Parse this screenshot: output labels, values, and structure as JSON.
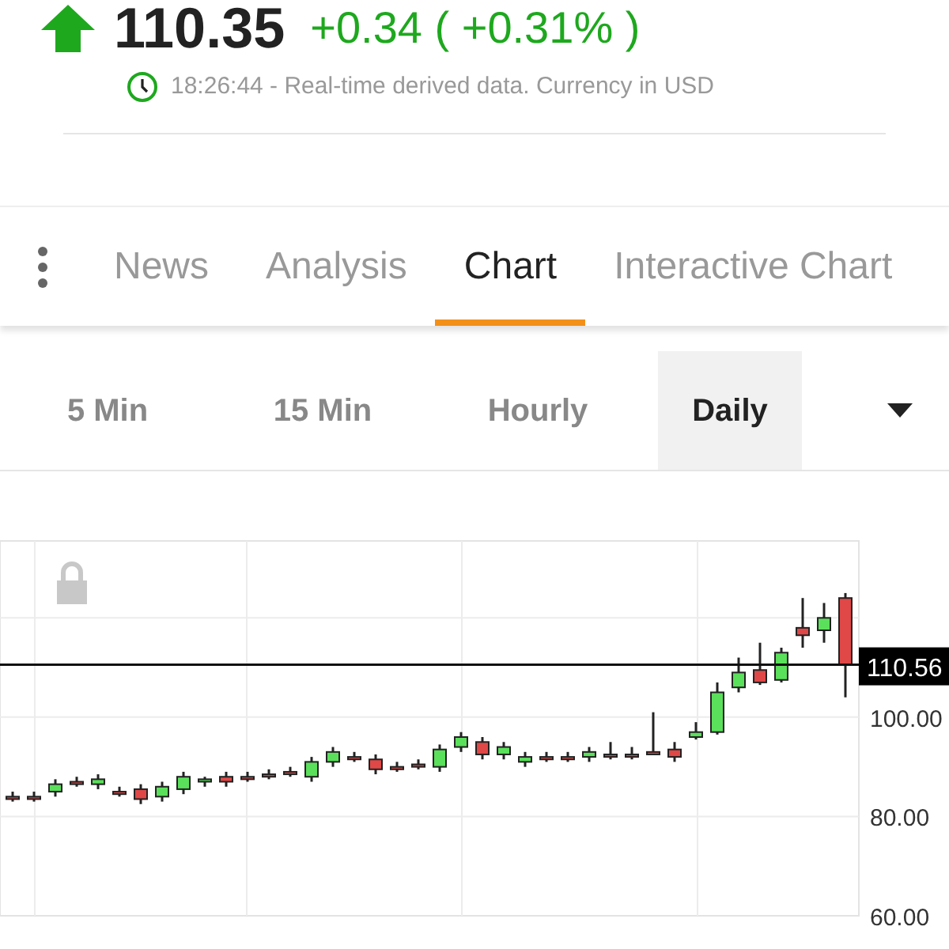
{
  "quote": {
    "price": "110.35",
    "change": "+0.34 ( +0.31% )",
    "rising": true,
    "timestamp": "18:26:44 - Real-time derived data. Currency in USD"
  },
  "tabs": [
    {
      "label": "News",
      "selected": false
    },
    {
      "label": "Analysis",
      "selected": false
    },
    {
      "label": "Chart",
      "selected": true
    },
    {
      "label": "Interactive Chart",
      "selected": false
    }
  ],
  "periods": [
    {
      "label": "5 Min",
      "selected": false
    },
    {
      "label": "15 Min",
      "selected": false
    },
    {
      "label": "Hourly",
      "selected": false
    },
    {
      "label": "Daily",
      "selected": true
    }
  ],
  "chart": {
    "chart_data": {
      "type": "candlestick",
      "grid": true,
      "ylim": [
        60,
        135.5
      ],
      "ref_lines": [
        {
          "axis": "y",
          "value": 110.56,
          "label": "110.56"
        }
      ],
      "ohlc": [
        [
          84,
          85,
          83,
          83.5
        ],
        [
          84,
          85,
          83,
          83.5
        ],
        [
          85,
          87.5,
          84,
          86.5
        ],
        [
          87,
          88,
          86,
          86.5
        ],
        [
          86.5,
          88.5,
          85.5,
          87.5
        ],
        [
          85,
          86,
          84,
          84.5
        ],
        [
          85.5,
          86.5,
          82.5,
          83.5
        ],
        [
          84,
          87,
          83,
          86
        ],
        [
          85.5,
          89,
          84.5,
          88
        ],
        [
          87,
          88,
          86,
          87.5
        ],
        [
          88,
          89,
          86,
          87
        ],
        [
          88,
          89,
          87,
          87.5
        ],
        [
          88.5,
          89.5,
          87.5,
          88
        ],
        [
          89,
          90,
          88,
          88.5
        ],
        [
          88,
          92,
          87,
          91
        ],
        [
          91,
          94,
          90,
          93
        ],
        [
          92,
          93,
          91,
          91.5
        ],
        [
          91.5,
          92.5,
          88.5,
          89.5
        ],
        [
          90,
          91,
          89,
          89.5
        ],
        [
          90.5,
          91.5,
          89.5,
          90
        ],
        [
          90,
          94.5,
          89,
          93.5
        ],
        [
          94,
          97,
          93,
          96
        ],
        [
          95,
          96,
          91.5,
          92.5
        ],
        [
          92.5,
          95,
          91.5,
          94
        ],
        [
          91,
          93,
          90,
          92
        ],
        [
          92,
          93,
          91,
          91.5
        ],
        [
          92,
          93,
          91,
          91.5
        ],
        [
          92,
          94,
          91,
          93
        ],
        [
          92.5,
          95,
          91.5,
          92
        ],
        [
          92.5,
          94,
          91.5,
          92
        ],
        [
          93,
          101,
          92.5,
          92.5
        ],
        [
          93.5,
          95,
          91,
          92
        ],
        [
          96,
          99,
          95.5,
          97
        ],
        [
          97,
          107,
          96.5,
          105
        ],
        [
          106,
          112,
          105,
          109
        ],
        [
          109.5,
          115,
          106.5,
          107
        ],
        [
          107.5,
          114,
          107,
          113
        ],
        [
          118,
          124,
          114,
          116.5
        ],
        [
          117.5,
          123,
          115,
          120
        ],
        [
          124,
          125,
          104,
          110.56
        ]
      ],
      "yticks": [
        {
          "value": 100,
          "label": "100.00"
        },
        {
          "value": 80,
          "label": "80.00"
        },
        {
          "value": 60,
          "label": "60.00"
        }
      ]
    }
  }
}
